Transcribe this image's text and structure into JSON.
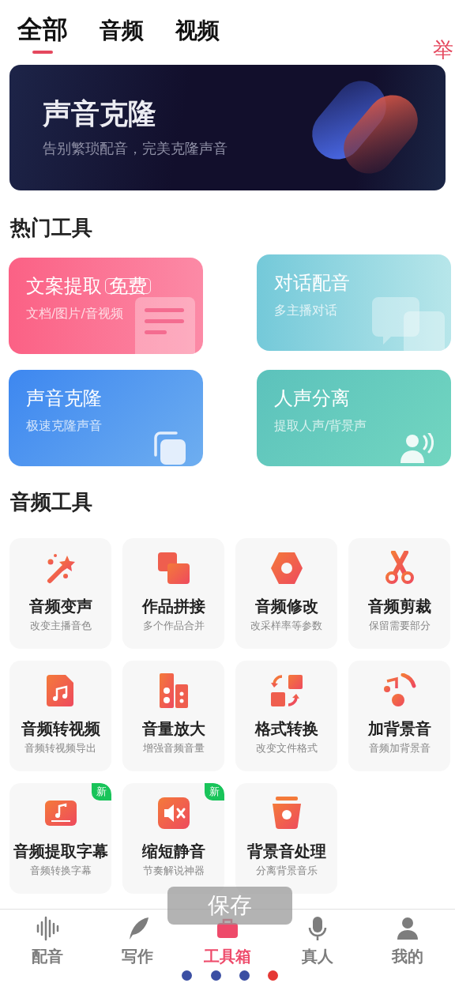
{
  "tabs": [
    {
      "label": "全部",
      "selected": true
    },
    {
      "label": "音频",
      "selected": false
    },
    {
      "label": "视频",
      "selected": false
    }
  ],
  "report_link": "举",
  "banner": {
    "title": "声音克隆",
    "subtitle": "告别繁琐配音，完美克隆声音"
  },
  "hot_tools": {
    "heading": "热门工具",
    "items": [
      {
        "title": "文案提取",
        "badge": "免费",
        "subtitle": "文档/图片/音视频",
        "kind": "document"
      },
      {
        "title": "对话配音",
        "subtitle": "多主播对话",
        "kind": "chat"
      },
      {
        "title": "声音克隆",
        "subtitle": "极速克隆声音",
        "kind": "copy"
      },
      {
        "title": "人声分离",
        "subtitle": "提取人声/背景声",
        "kind": "speaker"
      }
    ]
  },
  "audio_tools": {
    "heading": "音频工具",
    "items": [
      {
        "title": "音频变声",
        "subtitle": "改变主播音色",
        "kind": "wand",
        "new": false
      },
      {
        "title": "作品拼接",
        "subtitle": "多个作品合并",
        "kind": "squares",
        "new": false
      },
      {
        "title": "音频修改",
        "subtitle": "改采样率等参数",
        "kind": "hexagon",
        "new": false
      },
      {
        "title": "音频剪裁",
        "subtitle": "保留需要部分",
        "kind": "scissors",
        "new": false
      },
      {
        "title": "音频转视频",
        "subtitle": "音频转视频导出",
        "kind": "music-file",
        "new": false
      },
      {
        "title": "音量放大",
        "subtitle": "增强音频音量",
        "kind": "speakers",
        "new": false
      },
      {
        "title": "格式转换",
        "subtitle": "改变文件格式",
        "kind": "convert",
        "new": false
      },
      {
        "title": "加背景音",
        "subtitle": "音频加背景音",
        "kind": "notes",
        "new": false
      },
      {
        "title": "音频提取字幕",
        "subtitle": "音频转换字幕",
        "kind": "subtitle",
        "new": true,
        "badge": "新"
      },
      {
        "title": "缩短静音",
        "subtitle": "节奏解说神器",
        "kind": "mute",
        "new": true,
        "badge": "新"
      },
      {
        "title": "背景音处理",
        "subtitle": "分离背景音乐",
        "kind": "bucket",
        "new": false
      }
    ]
  },
  "bottom_nav": [
    {
      "label": "配音",
      "kind": "wave",
      "selected": false
    },
    {
      "label": "写作",
      "kind": "feather",
      "selected": false
    },
    {
      "label": "工具箱",
      "kind": "briefcase",
      "selected": true
    },
    {
      "label": "真人",
      "kind": "mic",
      "selected": false
    },
    {
      "label": "我的",
      "kind": "person",
      "selected": false
    }
  ],
  "toast": "保存",
  "overlay_dots": [
    {
      "color": "#3b4fa3"
    },
    {
      "color": "#3b4fa3"
    },
    {
      "color": "#3b4fa3"
    },
    {
      "color": "#e53935"
    }
  ]
}
